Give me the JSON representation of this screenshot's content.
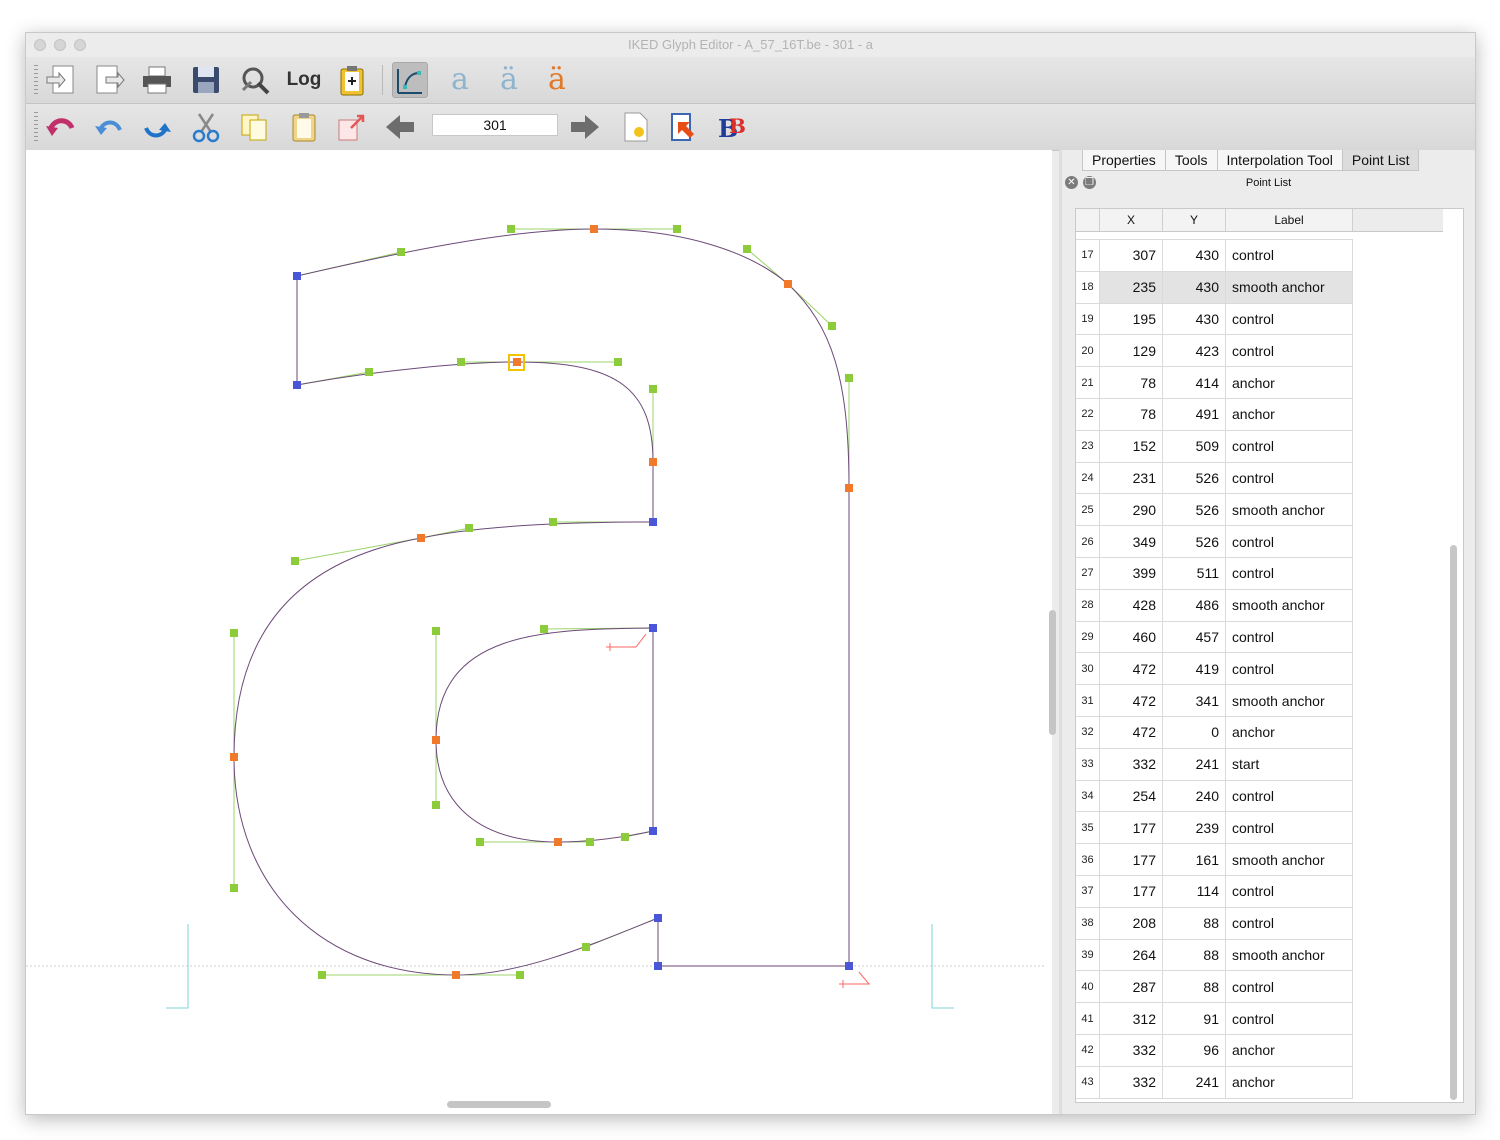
{
  "window": {
    "title": "IKED Glyph Editor - A_57_16T.be - 301 - a"
  },
  "toolbar1": {
    "buttons": [
      {
        "icon": "import-icon"
      },
      {
        "icon": "export-icon"
      },
      {
        "icon": "print-icon"
      },
      {
        "icon": "save-icon"
      },
      {
        "icon": "settings-wrench-icon"
      },
      {
        "icon": "log-icon",
        "label": "Log"
      },
      {
        "icon": "clipboard-add-icon"
      },
      {
        "icon": "outline-view-icon",
        "active": true
      },
      {
        "icon": "glyph-outline-a-icon",
        "label": "a"
      },
      {
        "icon": "glyph-dieresis-a-icon",
        "label": "ä"
      },
      {
        "icon": "glyph-filled-a-icon",
        "label": "ä"
      }
    ]
  },
  "toolbar2": {
    "glyph_number": "301",
    "buttons": [
      {
        "icon": "undo-all-icon"
      },
      {
        "icon": "undo-icon"
      },
      {
        "icon": "redo-icon"
      },
      {
        "icon": "cut-icon"
      },
      {
        "icon": "copy-icon"
      },
      {
        "icon": "paste-icon"
      },
      {
        "icon": "paste-special-icon"
      },
      {
        "icon": "previous-glyph-icon"
      },
      {
        "icon": "next-glyph-icon"
      },
      {
        "icon": "new-document-icon"
      },
      {
        "icon": "reload-icon"
      },
      {
        "icon": "bb-icon"
      }
    ]
  },
  "panel": {
    "tabs": [
      "Properties",
      "Tools",
      "Interpolation Tool",
      "Point List"
    ],
    "active_tab": "Point List",
    "dock_title": "Point List",
    "columns": [
      "X",
      "Y",
      "Label"
    ],
    "selected_row": "18",
    "rows": [
      {
        "n": "17",
        "x": "307",
        "y": "430",
        "label": "control"
      },
      {
        "n": "18",
        "x": "235",
        "y": "430",
        "label": "smooth anchor"
      },
      {
        "n": "19",
        "x": "195",
        "y": "430",
        "label": "control"
      },
      {
        "n": "20",
        "x": "129",
        "y": "423",
        "label": "control"
      },
      {
        "n": "21",
        "x": "78",
        "y": "414",
        "label": "anchor"
      },
      {
        "n": "22",
        "x": "78",
        "y": "491",
        "label": "anchor"
      },
      {
        "n": "23",
        "x": "152",
        "y": "509",
        "label": "control"
      },
      {
        "n": "24",
        "x": "231",
        "y": "526",
        "label": "control"
      },
      {
        "n": "25",
        "x": "290",
        "y": "526",
        "label": "smooth anchor"
      },
      {
        "n": "26",
        "x": "349",
        "y": "526",
        "label": "control"
      },
      {
        "n": "27",
        "x": "399",
        "y": "511",
        "label": "control"
      },
      {
        "n": "28",
        "x": "428",
        "y": "486",
        "label": "smooth anchor"
      },
      {
        "n": "29",
        "x": "460",
        "y": "457",
        "label": "control"
      },
      {
        "n": "30",
        "x": "472",
        "y": "419",
        "label": "control"
      },
      {
        "n": "31",
        "x": "472",
        "y": "341",
        "label": "smooth anchor"
      },
      {
        "n": "32",
        "x": "472",
        "y": "0",
        "label": "anchor"
      },
      {
        "n": "33",
        "x": "332",
        "y": "241",
        "label": "start"
      },
      {
        "n": "34",
        "x": "254",
        "y": "240",
        "label": "control"
      },
      {
        "n": "35",
        "x": "177",
        "y": "239",
        "label": "control"
      },
      {
        "n": "36",
        "x": "177",
        "y": "161",
        "label": "smooth anchor"
      },
      {
        "n": "37",
        "x": "177",
        "y": "114",
        "label": "control"
      },
      {
        "n": "38",
        "x": "208",
        "y": "88",
        "label": "control"
      },
      {
        "n": "39",
        "x": "264",
        "y": "88",
        "label": "smooth anchor"
      },
      {
        "n": "40",
        "x": "287",
        "y": "88",
        "label": "control"
      },
      {
        "n": "41",
        "x": "312",
        "y": "91",
        "label": "control"
      },
      {
        "n": "42",
        "x": "332",
        "y": "96",
        "label": "anchor"
      },
      {
        "n": "43",
        "x": "332",
        "y": "241",
        "label": "anchor"
      }
    ]
  },
  "colors": {
    "outline": "#6b4a78",
    "handle": "#9bd46a",
    "control_point": "#8ccc3a",
    "smooth_anchor": "#f07a2a",
    "anchor": "#4a56d8",
    "selected": "#f2c400",
    "baseline": "#c8c8c8",
    "guide": "#7fd6d6",
    "marker": "#ff6666"
  }
}
